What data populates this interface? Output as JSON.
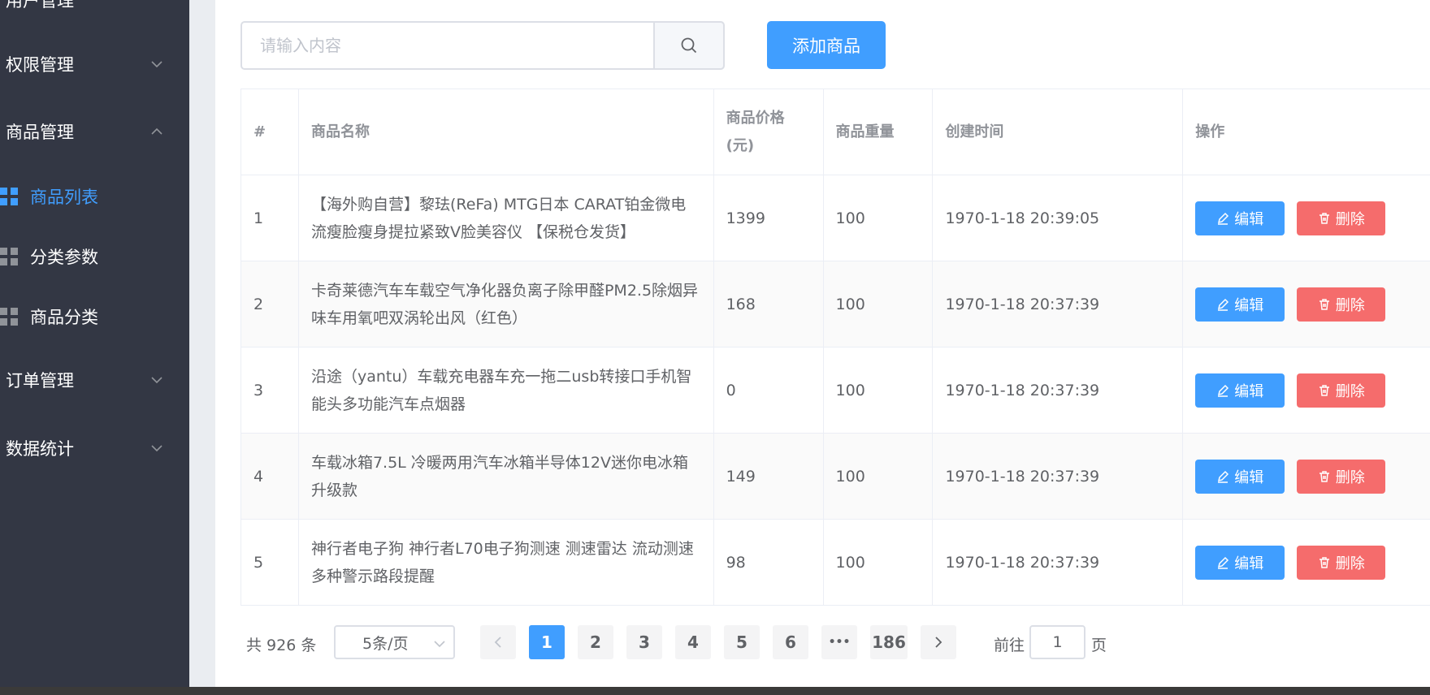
{
  "sidebar": {
    "top_partial": "用户管理",
    "menus": [
      {
        "label": "权限管理",
        "expanded": false
      },
      {
        "label": "商品管理",
        "expanded": true
      },
      {
        "label": "订单管理",
        "expanded": false
      },
      {
        "label": "数据统计",
        "expanded": false
      }
    ],
    "sub_items": [
      {
        "label": "商品列表",
        "active": true
      },
      {
        "label": "分类参数",
        "active": false
      },
      {
        "label": "商品分类",
        "active": false
      }
    ]
  },
  "toolbar": {
    "search_placeholder": "请输入内容",
    "search_value": "",
    "add_label": "添加商品"
  },
  "table": {
    "columns": [
      "#",
      "商品名称",
      "商品价格(元)",
      "商品重量",
      "创建时间",
      "操作"
    ],
    "rows": [
      {
        "index": "1",
        "name": "【海外购自营】黎珐(ReFa) MTG日本 CARAT铂金微电流瘦脸瘦身提拉紧致V脸美容仪 【保税仓发货】",
        "price": "1399",
        "weight": "100",
        "created": "1970-1-18 20:39:05"
      },
      {
        "index": "2",
        "name": "卡奇莱德汽车车载空气净化器负离子除甲醛PM2.5除烟异味车用氧吧双涡轮出风（红色）",
        "price": "168",
        "weight": "100",
        "created": "1970-1-18 20:37:39"
      },
      {
        "index": "3",
        "name": "沿途（yantu）车载充电器车充一拖二usb转接口手机智能头多功能汽车点烟器",
        "price": "0",
        "weight": "100",
        "created": "1970-1-18 20:37:39"
      },
      {
        "index": "4",
        "name": "车载冰箱7.5L 冷暖两用汽车冰箱半导体12V迷你电冰箱升级款",
        "price": "149",
        "weight": "100",
        "created": "1970-1-18 20:37:39"
      },
      {
        "index": "5",
        "name": "神行者电子狗 神行者L70电子狗测速 测速雷达 流动测速 多种警示路段提醒",
        "price": "98",
        "weight": "100",
        "created": "1970-1-18 20:37:39"
      }
    ],
    "edit_label": "编辑",
    "delete_label": "删除"
  },
  "pagination": {
    "total_label": "共 926 条",
    "page_size_label": "5条/页",
    "pages": [
      "1",
      "2",
      "3",
      "4",
      "5",
      "6",
      "•••",
      "186"
    ],
    "current_page": "1",
    "jump_prefix": "前往",
    "jump_value": "1",
    "jump_suffix": "页"
  }
}
